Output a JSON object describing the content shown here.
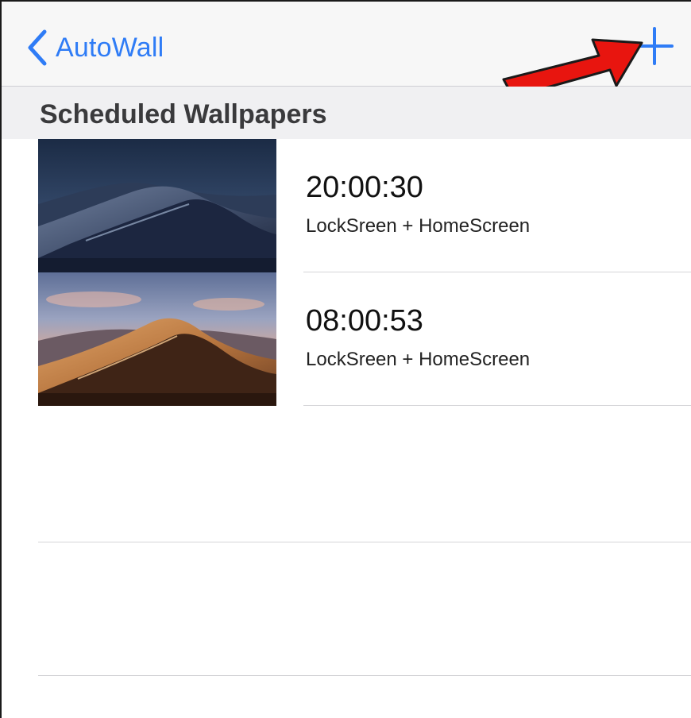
{
  "theme": {
    "accent": "#2f7cf6",
    "annotation_arrow": "#e8150f"
  },
  "nav": {
    "back_label": "AutoWall",
    "back_icon": "chevron-left-icon",
    "add_icon": "plus-icon"
  },
  "section": {
    "title": "Scheduled Wallpapers"
  },
  "wallpapers": [
    {
      "time": "20:00:30",
      "target": "LockSreen + HomeScreen",
      "thumbnail": "night-desert-dunes"
    },
    {
      "time": "08:00:53",
      "target": "LockSreen + HomeScreen",
      "thumbnail": "day-desert-dunes"
    }
  ]
}
